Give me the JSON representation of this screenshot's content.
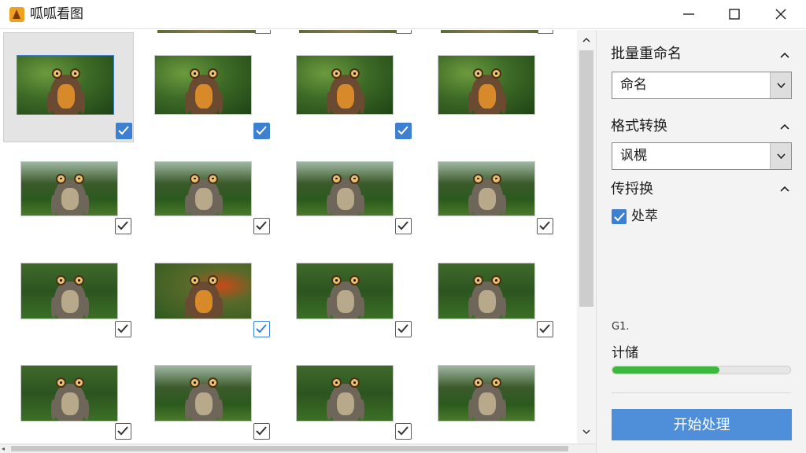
{
  "window": {
    "title": "呱呱看图"
  },
  "gallery": {
    "rows": [
      [
        {
          "bg": "g1",
          "checked": true,
          "cb": "blue",
          "selected": true
        },
        {
          "bg": "g1",
          "checked": true,
          "cb": "blue"
        },
        {
          "bg": "g1",
          "checked": true,
          "cb": "blue"
        },
        {
          "bg": "g1",
          "checked": false,
          "cb": "none"
        }
      ],
      [
        {
          "bg": "g2",
          "checked": true,
          "cb": "gray"
        },
        {
          "bg": "g2",
          "checked": true,
          "cb": "gray"
        },
        {
          "bg": "g2",
          "checked": true,
          "cb": "gray"
        },
        {
          "bg": "g2",
          "checked": true,
          "cb": "gray"
        }
      ],
      [
        {
          "bg": "g4",
          "checked": true,
          "cb": "gray"
        },
        {
          "bg": "g3",
          "checked": true,
          "cb": "blue-outline"
        },
        {
          "bg": "g4",
          "checked": true,
          "cb": "gray"
        },
        {
          "bg": "g4",
          "checked": true,
          "cb": "gray"
        }
      ],
      [
        {
          "bg": "g4",
          "checked": true,
          "cb": "gray"
        },
        {
          "bg": "g2",
          "checked": true,
          "cb": "gray"
        },
        {
          "bg": "g4",
          "checked": true,
          "cb": "gray"
        },
        {
          "bg": "g2",
          "checked": false,
          "cb": "none"
        }
      ]
    ]
  },
  "panel": {
    "rename": {
      "title": "批量重命名",
      "select_value": "命名"
    },
    "format": {
      "title": "格式转换",
      "select_value": "讽榥"
    },
    "convert": {
      "title": "传捋换",
      "checkbox_label": "处萃",
      "checked": true
    },
    "stats": {
      "label_small": "G1.",
      "label": "计储"
    },
    "progress": {
      "fraction": 0.6
    },
    "start_button": "开始处理"
  },
  "colors": {
    "accent": "#3d7fd0",
    "progress": "#3cb93c",
    "button": "#4f8fd9"
  }
}
